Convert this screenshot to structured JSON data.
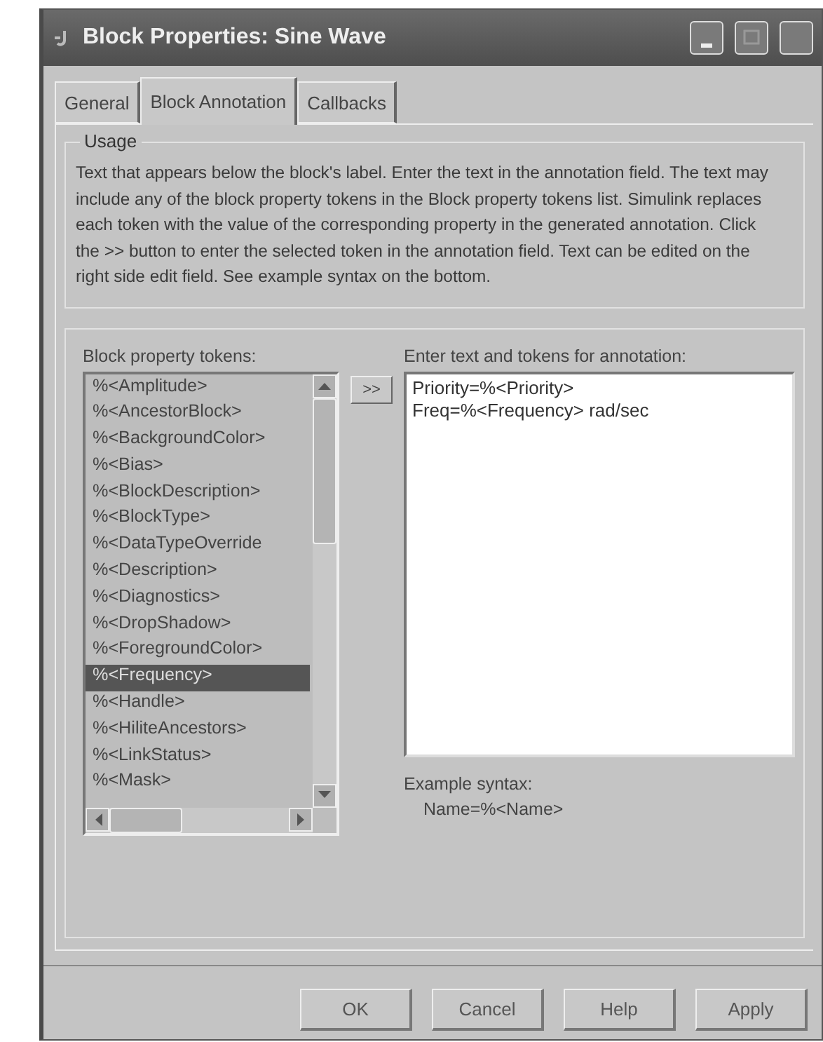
{
  "window": {
    "title": "Block Properties: Sine Wave"
  },
  "tabs": [
    {
      "label": "General",
      "selected": false
    },
    {
      "label": "Block Annotation",
      "selected": true
    },
    {
      "label": "Callbacks",
      "selected": false
    }
  ],
  "usage": {
    "title": "Usage",
    "text": "Text that appears below the block's label. Enter the text in the annotation field. The text may include any of the block property tokens in the Block property tokens list. Simulink replaces each token with the value of the corresponding property in the generated annotation. Click the >> button to enter the selected token in the annotation field. Text can be edited on the right side edit field. See example syntax on the bottom."
  },
  "tokens": {
    "label": "Block property tokens:",
    "items": [
      {
        "label": "%<Amplitude>",
        "selected": false
      },
      {
        "label": "%<AncestorBlock>",
        "selected": false
      },
      {
        "label": "%<BackgroundColor>",
        "selected": false
      },
      {
        "label": "%<Bias>",
        "selected": false
      },
      {
        "label": "%<BlockDescription>",
        "selected": false
      },
      {
        "label": "%<BlockType>",
        "selected": false
      },
      {
        "label": "%<DataTypeOverride",
        "selected": false
      },
      {
        "label": "%<Description>",
        "selected": false
      },
      {
        "label": "%<Diagnostics>",
        "selected": false
      },
      {
        "label": "%<DropShadow>",
        "selected": false
      },
      {
        "label": "%<ForegroundColor>",
        "selected": false
      },
      {
        "label": "%<Frequency>",
        "selected": true
      },
      {
        "label": "%<Handle>",
        "selected": false
      },
      {
        "label": "%<HiliteAncestors>",
        "selected": false
      },
      {
        "label": "%<LinkStatus>",
        "selected": false
      },
      {
        "label": "%<Mask>",
        "selected": false
      }
    ]
  },
  "insert_button": ">>",
  "annotation": {
    "label": "Enter text and tokens for annotation:",
    "value": "Priority=%<Priority>\nFreq=%<Frequency> rad/sec"
  },
  "example": {
    "label": "Example syntax:",
    "text": "Name=%<Name>"
  },
  "buttons": [
    "OK",
    "Cancel",
    "Help",
    "Apply"
  ]
}
